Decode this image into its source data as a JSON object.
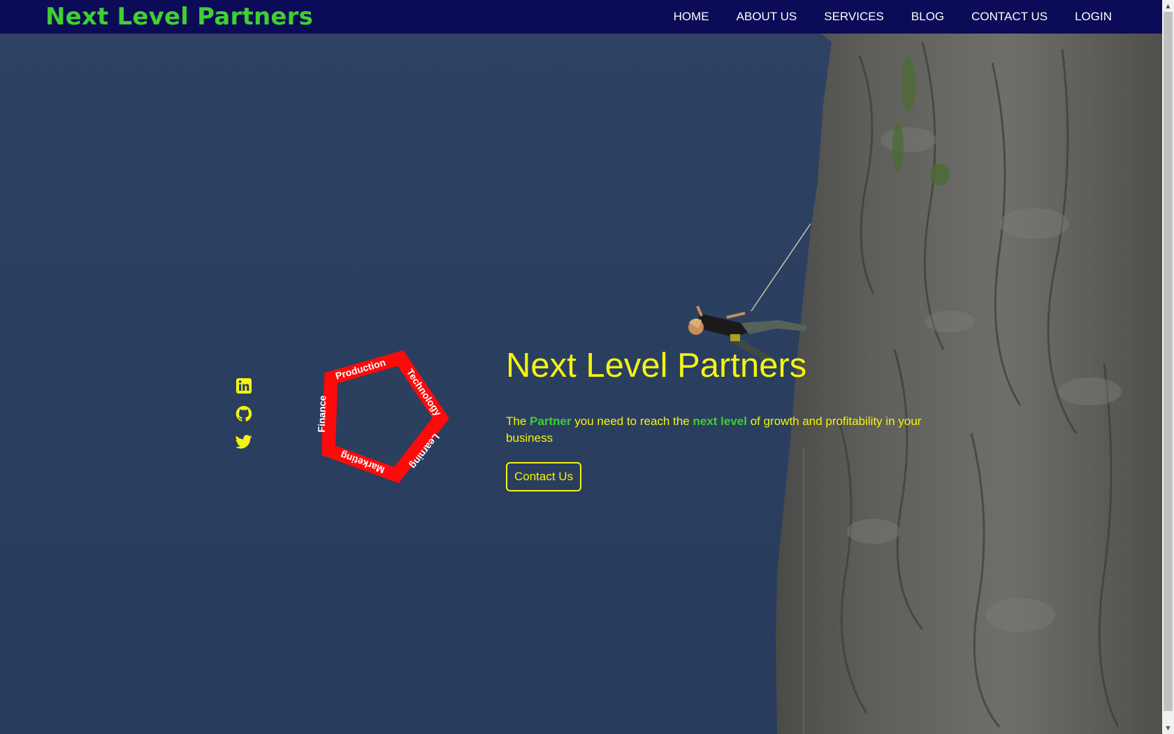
{
  "navbar": {
    "brand": "Next Level Partners",
    "links": [
      "HOME",
      "ABOUT US",
      "SERVICES",
      "BLOG",
      "CONTACT US",
      "LOGIN"
    ]
  },
  "social": {
    "icons": [
      "linkedin-icon",
      "github-icon",
      "twitter-icon"
    ]
  },
  "pentagon": {
    "labels": [
      "Technology",
      "Learning",
      "Marketing",
      "Finance",
      "Production"
    ],
    "color": "#ff0a0a"
  },
  "hero": {
    "title": "Next Level Partners",
    "tagline_parts": [
      "The ",
      "Partner",
      " you need to reach the ",
      "next level",
      " of growth and profitability in your business"
    ],
    "button": "Contact Us"
  },
  "colors": {
    "brand_green": "#3fcf32",
    "accent_yellow": "#f4f40f",
    "navbar_bg": "#0b0b57",
    "hero_bg": "#2b3f5f"
  }
}
